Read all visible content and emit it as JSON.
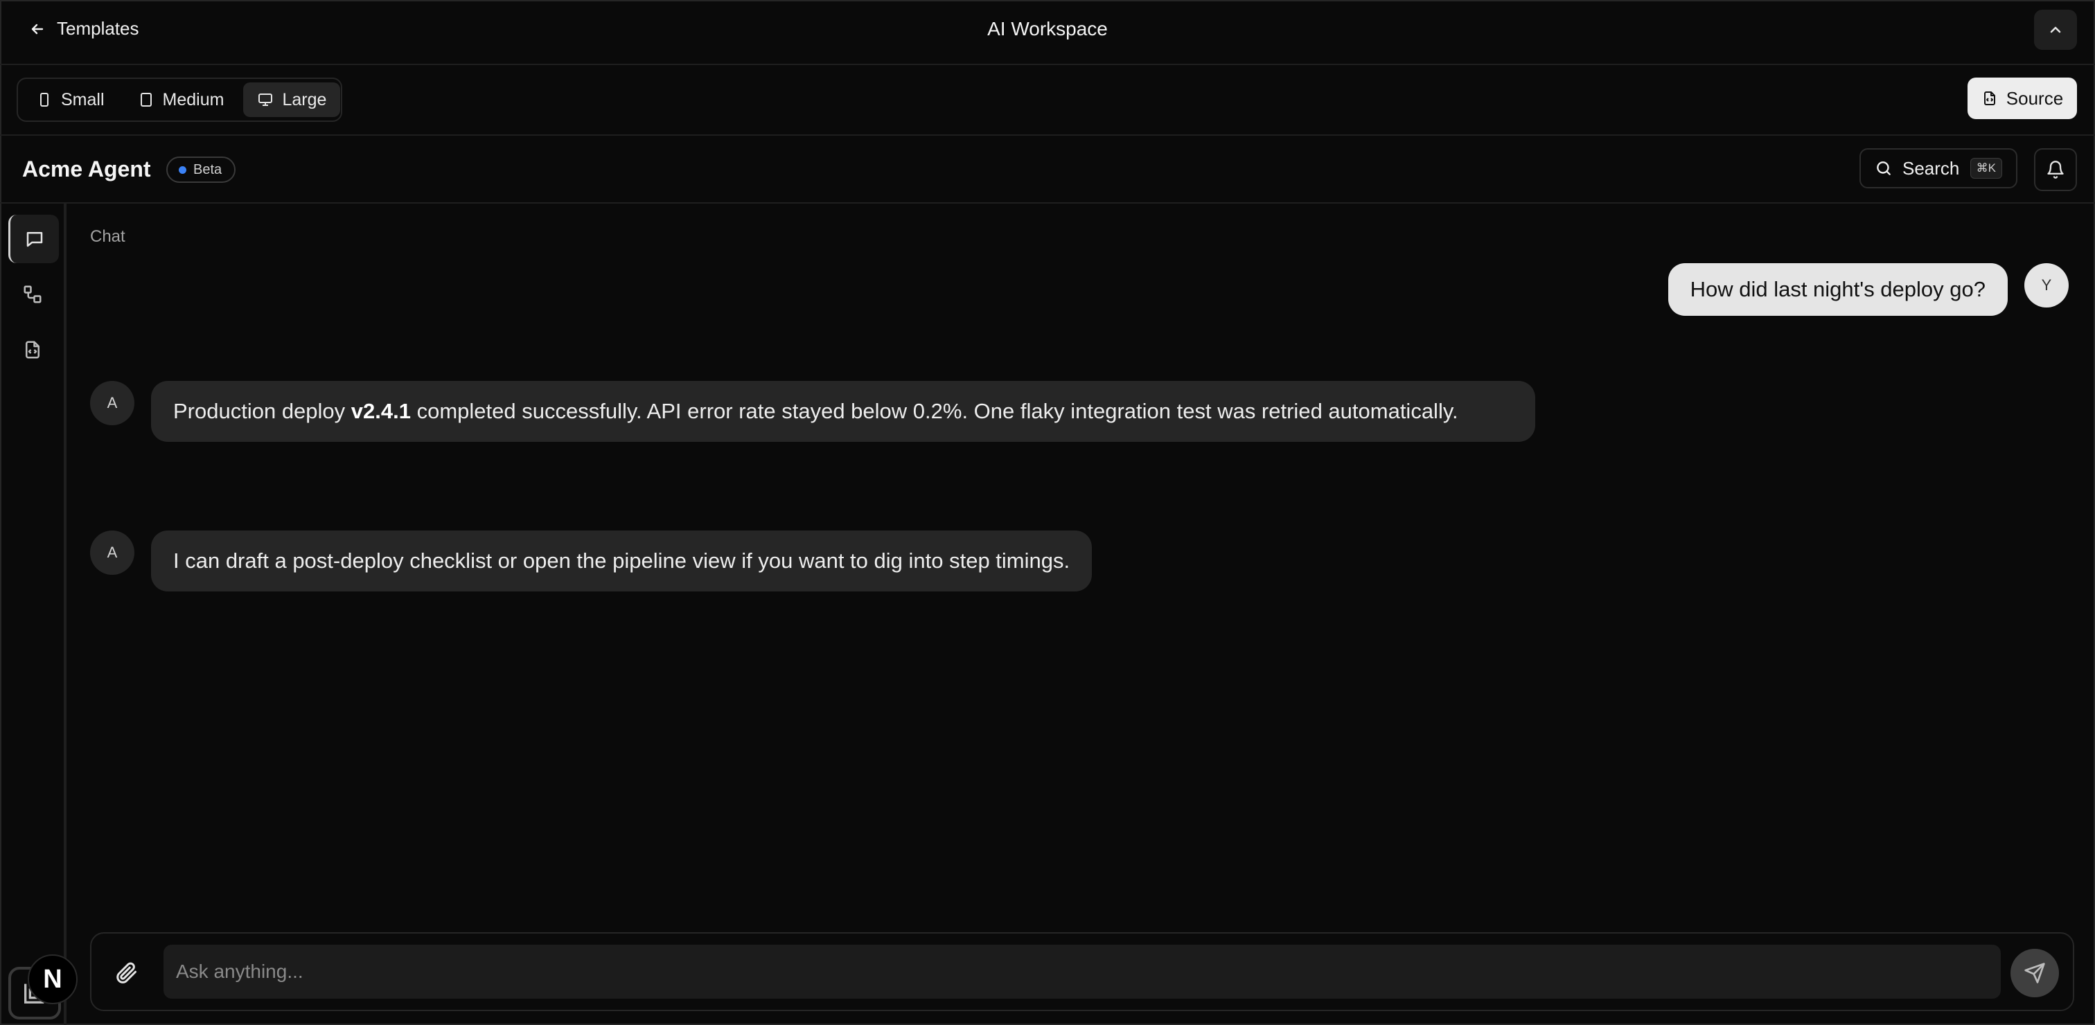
{
  "topbar": {
    "back_label": "Templates",
    "title": "AI Workspace"
  },
  "sizes": [
    {
      "label": "Small",
      "icon": "phone-icon"
    },
    {
      "label": "Medium",
      "icon": "tablet-icon"
    },
    {
      "label": "Large",
      "icon": "monitor-icon",
      "active": true
    }
  ],
  "source_label": "Source",
  "app": {
    "name": "Acme Agent",
    "badge": "Beta",
    "search_label": "Search",
    "search_shortcut": "⌘K"
  },
  "rail": [
    {
      "icon": "chat-icon",
      "active": true
    },
    {
      "icon": "workflow-icon"
    },
    {
      "icon": "code-file-icon"
    }
  ],
  "chat": {
    "section_label": "Chat",
    "user_message": "How did last night's deploy go?",
    "user_avatar": "Y",
    "agent_avatar": "A",
    "agent_msg1_pre": "Production deploy ",
    "agent_msg1_bold": "v2.4.1",
    "agent_msg1_post": " completed successfully. API error rate stayed below 0.2%. One flaky integration test was retried automatically.",
    "agent_msg2": "I can draft a post-deploy checklist or open the pipeline view if you want to dig into step timings."
  },
  "composer": {
    "placeholder": "Ask anything..."
  },
  "logo_letter": "N"
}
